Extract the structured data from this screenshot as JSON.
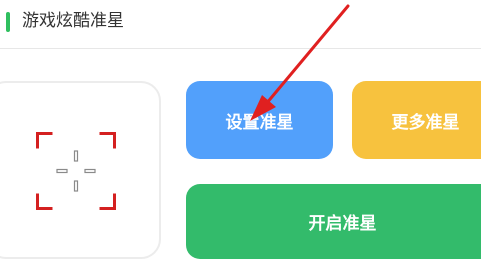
{
  "header": {
    "title": "游戏炫酷准星",
    "accent_color": "#2fbf5f"
  },
  "preview": {
    "icon": "crosshair-icon",
    "crosshair_color": "#d42020"
  },
  "buttons": {
    "set_crosshair": {
      "label": "设置准星",
      "color": "#52a0fb"
    },
    "more_crosshair": {
      "label": "更多准星",
      "color": "#f7c23e"
    },
    "start_crosshair": {
      "label": "开启准星",
      "color": "#33bb6b"
    }
  },
  "annotation": {
    "icon": "red-arrow-icon",
    "color": "#e02020"
  }
}
